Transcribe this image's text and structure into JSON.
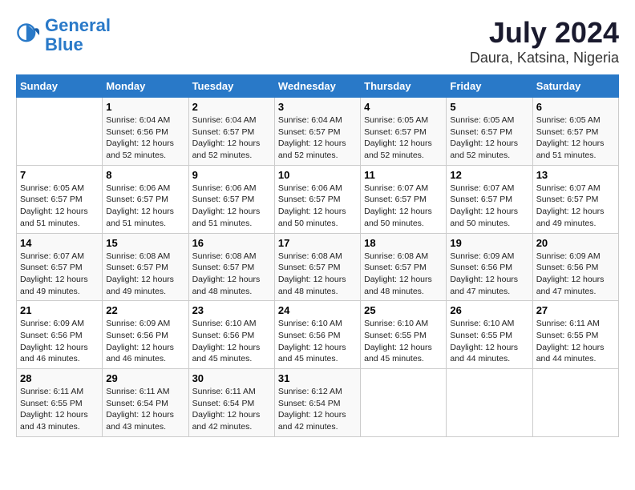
{
  "logo": {
    "line1": "General",
    "line2": "Blue"
  },
  "title": "July 2024",
  "subtitle": "Daura, Katsina, Nigeria",
  "days_header": [
    "Sunday",
    "Monday",
    "Tuesday",
    "Wednesday",
    "Thursday",
    "Friday",
    "Saturday"
  ],
  "weeks": [
    [
      {
        "num": "",
        "info": ""
      },
      {
        "num": "1",
        "info": "Sunrise: 6:04 AM\nSunset: 6:56 PM\nDaylight: 12 hours\nand 52 minutes."
      },
      {
        "num": "2",
        "info": "Sunrise: 6:04 AM\nSunset: 6:57 PM\nDaylight: 12 hours\nand 52 minutes."
      },
      {
        "num": "3",
        "info": "Sunrise: 6:04 AM\nSunset: 6:57 PM\nDaylight: 12 hours\nand 52 minutes."
      },
      {
        "num": "4",
        "info": "Sunrise: 6:05 AM\nSunset: 6:57 PM\nDaylight: 12 hours\nand 52 minutes."
      },
      {
        "num": "5",
        "info": "Sunrise: 6:05 AM\nSunset: 6:57 PM\nDaylight: 12 hours\nand 52 minutes."
      },
      {
        "num": "6",
        "info": "Sunrise: 6:05 AM\nSunset: 6:57 PM\nDaylight: 12 hours\nand 51 minutes."
      }
    ],
    [
      {
        "num": "7",
        "info": "Sunrise: 6:05 AM\nSunset: 6:57 PM\nDaylight: 12 hours\nand 51 minutes."
      },
      {
        "num": "8",
        "info": "Sunrise: 6:06 AM\nSunset: 6:57 PM\nDaylight: 12 hours\nand 51 minutes."
      },
      {
        "num": "9",
        "info": "Sunrise: 6:06 AM\nSunset: 6:57 PM\nDaylight: 12 hours\nand 51 minutes."
      },
      {
        "num": "10",
        "info": "Sunrise: 6:06 AM\nSunset: 6:57 PM\nDaylight: 12 hours\nand 50 minutes."
      },
      {
        "num": "11",
        "info": "Sunrise: 6:07 AM\nSunset: 6:57 PM\nDaylight: 12 hours\nand 50 minutes."
      },
      {
        "num": "12",
        "info": "Sunrise: 6:07 AM\nSunset: 6:57 PM\nDaylight: 12 hours\nand 50 minutes."
      },
      {
        "num": "13",
        "info": "Sunrise: 6:07 AM\nSunset: 6:57 PM\nDaylight: 12 hours\nand 49 minutes."
      }
    ],
    [
      {
        "num": "14",
        "info": "Sunrise: 6:07 AM\nSunset: 6:57 PM\nDaylight: 12 hours\nand 49 minutes."
      },
      {
        "num": "15",
        "info": "Sunrise: 6:08 AM\nSunset: 6:57 PM\nDaylight: 12 hours\nand 49 minutes."
      },
      {
        "num": "16",
        "info": "Sunrise: 6:08 AM\nSunset: 6:57 PM\nDaylight: 12 hours\nand 48 minutes."
      },
      {
        "num": "17",
        "info": "Sunrise: 6:08 AM\nSunset: 6:57 PM\nDaylight: 12 hours\nand 48 minutes."
      },
      {
        "num": "18",
        "info": "Sunrise: 6:08 AM\nSunset: 6:57 PM\nDaylight: 12 hours\nand 48 minutes."
      },
      {
        "num": "19",
        "info": "Sunrise: 6:09 AM\nSunset: 6:56 PM\nDaylight: 12 hours\nand 47 minutes."
      },
      {
        "num": "20",
        "info": "Sunrise: 6:09 AM\nSunset: 6:56 PM\nDaylight: 12 hours\nand 47 minutes."
      }
    ],
    [
      {
        "num": "21",
        "info": "Sunrise: 6:09 AM\nSunset: 6:56 PM\nDaylight: 12 hours\nand 46 minutes."
      },
      {
        "num": "22",
        "info": "Sunrise: 6:09 AM\nSunset: 6:56 PM\nDaylight: 12 hours\nand 46 minutes."
      },
      {
        "num": "23",
        "info": "Sunrise: 6:10 AM\nSunset: 6:56 PM\nDaylight: 12 hours\nand 45 minutes."
      },
      {
        "num": "24",
        "info": "Sunrise: 6:10 AM\nSunset: 6:56 PM\nDaylight: 12 hours\nand 45 minutes."
      },
      {
        "num": "25",
        "info": "Sunrise: 6:10 AM\nSunset: 6:55 PM\nDaylight: 12 hours\nand 45 minutes."
      },
      {
        "num": "26",
        "info": "Sunrise: 6:10 AM\nSunset: 6:55 PM\nDaylight: 12 hours\nand 44 minutes."
      },
      {
        "num": "27",
        "info": "Sunrise: 6:11 AM\nSunset: 6:55 PM\nDaylight: 12 hours\nand 44 minutes."
      }
    ],
    [
      {
        "num": "28",
        "info": "Sunrise: 6:11 AM\nSunset: 6:55 PM\nDaylight: 12 hours\nand 43 minutes."
      },
      {
        "num": "29",
        "info": "Sunrise: 6:11 AM\nSunset: 6:54 PM\nDaylight: 12 hours\nand 43 minutes."
      },
      {
        "num": "30",
        "info": "Sunrise: 6:11 AM\nSunset: 6:54 PM\nDaylight: 12 hours\nand 42 minutes."
      },
      {
        "num": "31",
        "info": "Sunrise: 6:12 AM\nSunset: 6:54 PM\nDaylight: 12 hours\nand 42 minutes."
      },
      {
        "num": "",
        "info": ""
      },
      {
        "num": "",
        "info": ""
      },
      {
        "num": "",
        "info": ""
      }
    ]
  ]
}
